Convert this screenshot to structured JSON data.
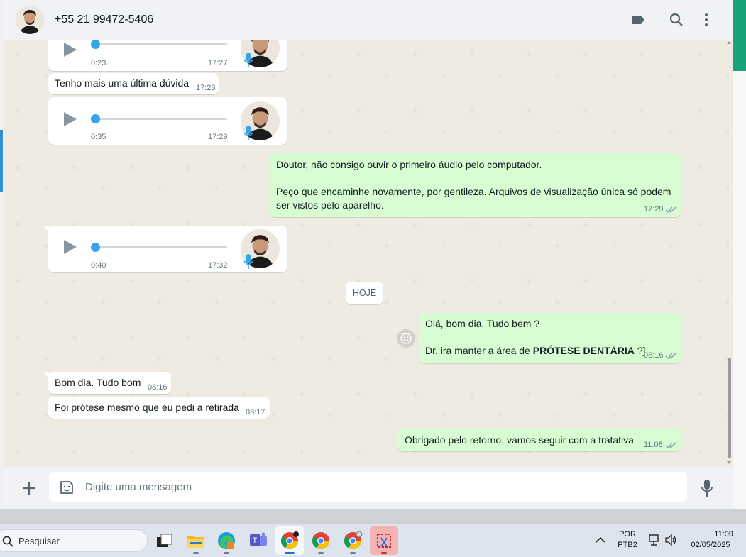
{
  "header": {
    "contact": "+55 21 99472-5406",
    "icons": [
      "label-icon",
      "search-icon",
      "menu-icon"
    ]
  },
  "messages": {
    "audio1": {
      "duration": "0:23",
      "time": "17:27"
    },
    "text1": {
      "text": "Tenho mais uma última dúvida",
      "time": "17:28"
    },
    "audio2": {
      "duration": "0:35",
      "time": "17:29"
    },
    "out1": {
      "line1": "Doutor, não consigo ouvir o primeiro áudio pelo computador.",
      "line2": "Peço que encaminhe novamente, por gentileza. Arquivos de visualização única só podem",
      "line3": "ser vistos pelo aparelho.",
      "time": "17:29"
    },
    "audio3": {
      "duration": "0:40",
      "time": "17:32"
    },
    "date_chip": "HOJE",
    "out2": {
      "line1": "Olá, bom dia. Tudo bem ?",
      "line2_prefix": "Dr. ira manter a área de ",
      "line2_bold": "PRÓTESE DENTÁRIA",
      "line2_suffix": " ?]",
      "time": "08:16"
    },
    "in2": {
      "text": "Bom dia. Tudo bom",
      "time": "08:16"
    },
    "in3": {
      "text": "Foi prótese mesmo que eu pedi a retirada",
      "time": "08:17"
    },
    "out3": {
      "text": "Obrigado pelo retorno, vamos seguir com a tratativa",
      "time": "11:08"
    }
  },
  "compose": {
    "placeholder": "Digite uma mensagem"
  },
  "taskbar": {
    "search_label": "Pesquisar",
    "lang1": "POR",
    "lang2": "PTB2",
    "clock_time": "11:09",
    "clock_date": "02/05/2025"
  },
  "colors": {
    "incoming": "#ffffff",
    "outgoing": "#d9fdd3",
    "chat_bg": "#efeae2",
    "accent_blue": "#34a5e8",
    "header_bg": "#f0f2f5"
  }
}
